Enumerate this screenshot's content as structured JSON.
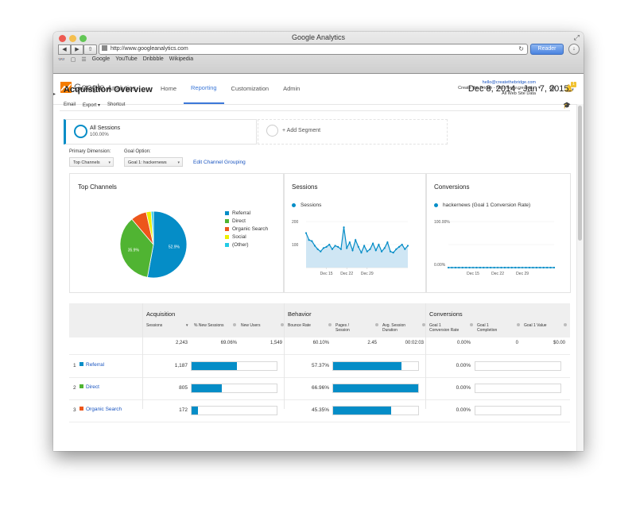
{
  "window": {
    "title": "Google Analytics"
  },
  "browser": {
    "url": "http://www.googleanalytics.com",
    "reader_label": "Reader",
    "bookmarks": [
      "Google",
      "YouTube",
      "Dribbble",
      "Wikipedia"
    ]
  },
  "header": {
    "logo_word1": "Google",
    "logo_word2": "Analytics",
    "nav": [
      "Home",
      "Reporting",
      "Customization",
      "Admin"
    ],
    "active_nav": 1,
    "account_email": "hello@createthebridge.com",
    "account_property": "Create the Bridge - http://www.created...",
    "account_view": "All Web Site Data",
    "notification_count": "1"
  },
  "page": {
    "title": "Acquisition Overview",
    "date_range": "Dec 8, 2014 - Jan 7, 2015",
    "actions": [
      "Email",
      "Export ▾",
      "Shortcut"
    ]
  },
  "segments": {
    "active_name": "All Sessions",
    "active_pct": "100.00%",
    "add_label": "+ Add Segment"
  },
  "dimensions": {
    "primary_label": "Primary Dimension:",
    "primary_value": "Top Channels",
    "goal_label": "Goal Option:",
    "goal_value": "Goal 1: hackernews",
    "edit_link": "Edit Channel Grouping"
  },
  "panels": {
    "top_channels_title": "Top Channels",
    "sessions_title": "Sessions",
    "conversions_title": "Conversions",
    "sessions_series": "Sessions",
    "conversions_series": "hackernews (Goal 1 Conversion Rate)"
  },
  "chart_data": [
    {
      "type": "pie",
      "title": "Top Channels",
      "labels": [
        "Referral",
        "Direct",
        "Organic Search",
        "Social",
        "(Other)"
      ],
      "values": [
        52.9,
        35.9,
        7.7,
        2.4,
        1.1
      ],
      "slice_labels": [
        "52.9%",
        "35.9%",
        "",
        "",
        ""
      ],
      "colors": [
        "#058dc7",
        "#50b432",
        "#ed561b",
        "#edef00",
        "#24cbe5"
      ]
    },
    {
      "type": "area",
      "title": "Sessions",
      "series": [
        {
          "name": "Sessions",
          "values": [
            150,
            120,
            115,
            95,
            80,
            70,
            85,
            90,
            100,
            80,
            95,
            90,
            80,
            175,
            85,
            110,
            75,
            120,
            90,
            65,
            95,
            70,
            80,
            105,
            75,
            100,
            70,
            85,
            110,
            70,
            65,
            80,
            90,
            100,
            80,
            95
          ]
        }
      ],
      "ylim": [
        0,
        200
      ],
      "yticks": [
        "200",
        "100"
      ],
      "xticks": [
        {
          "label": "Dec 15",
          "index": 7
        },
        {
          "label": "Dec 22",
          "index": 14
        },
        {
          "label": "Dec 29",
          "index": 21
        }
      ],
      "color": "#058dc7"
    },
    {
      "type": "line",
      "title": "Conversions",
      "series": [
        {
          "name": "hackernews (Goal 1 Conversion Rate)",
          "values": [
            0,
            0,
            0,
            0,
            0,
            0,
            0,
            0,
            0,
            0,
            0,
            0,
            0,
            0,
            0,
            0,
            0,
            0,
            0,
            0,
            0,
            0,
            0,
            0,
            0,
            0,
            0,
            0,
            0,
            0,
            0
          ]
        }
      ],
      "ylim": [
        0,
        100
      ],
      "yticks": [
        "100.00%",
        "0.00%"
      ],
      "xticks": [
        {
          "label": "Dec 15",
          "index": 7
        },
        {
          "label": "Dec 22",
          "index": 14
        },
        {
          "label": "Dec 29",
          "index": 21
        }
      ],
      "color": "#058dc7"
    }
  ],
  "table": {
    "groups": [
      "Acquisition",
      "Behavior",
      "Conversions"
    ],
    "columns": [
      "Sessions",
      "% New Sessions",
      "New Users",
      "Bounce Rate",
      "Pages / Session",
      "Avg. Session Duration",
      "Goal 1 Conversion Rate",
      "Goal 1 Completion",
      "Goal 1 Value"
    ],
    "totals": [
      "2,243",
      "69.06%",
      "1,549",
      "60.10%",
      "2.45",
      "00:02:03",
      "0.00%",
      "0",
      "$0.00"
    ],
    "rows": [
      {
        "rank": "1",
        "channel": "Referral",
        "color": "#058dc7",
        "sessions": "1,187",
        "sessions_share": 0.529,
        "bounce": "57.37%",
        "bounce_share": 0.8,
        "conv": "0.00%"
      },
      {
        "rank": "2",
        "channel": "Direct",
        "color": "#50b432",
        "sessions": "805",
        "sessions_share": 0.359,
        "bounce": "66.96%",
        "bounce_share": 1.0,
        "conv": "0.00%"
      },
      {
        "rank": "3",
        "channel": "Organic Search",
        "color": "#ed561b",
        "sessions": "172",
        "sessions_share": 0.077,
        "bounce": "45.35%",
        "bounce_share": 0.68,
        "conv": "0.00%"
      }
    ]
  }
}
